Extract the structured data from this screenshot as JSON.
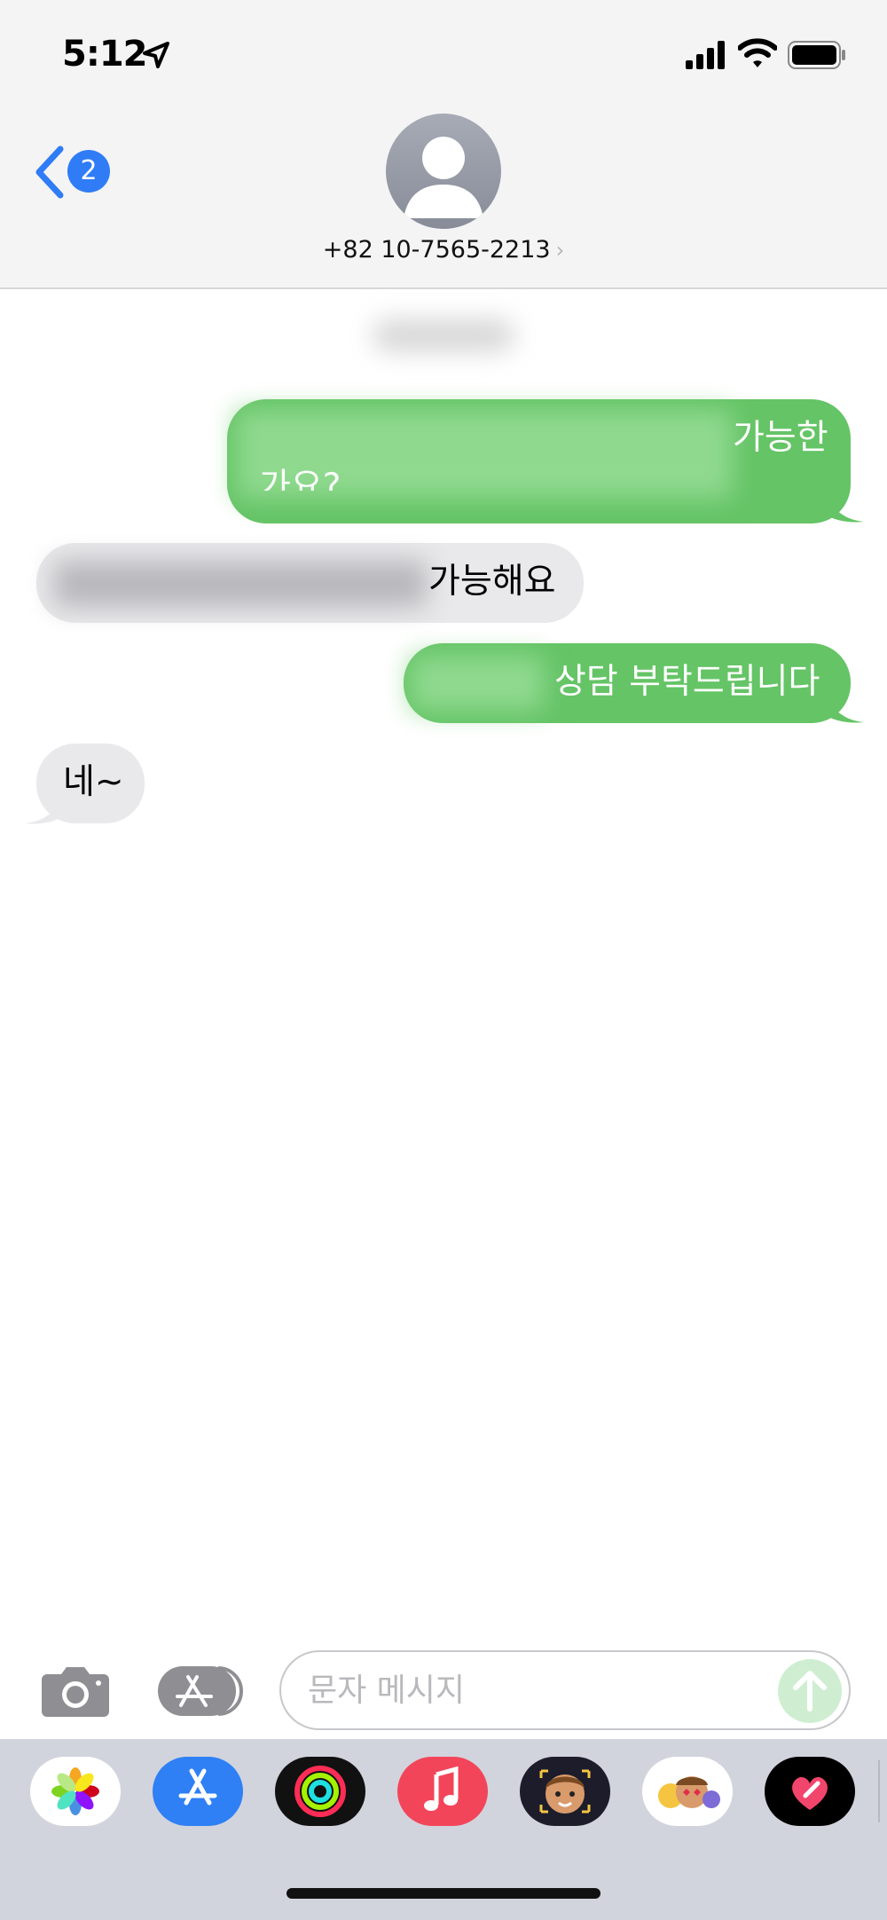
{
  "status_bar": {
    "time": "5:12"
  },
  "header": {
    "back_badge": "2",
    "contact_name": "+82 10-7565-2213",
    "contact_chevron": "›"
  },
  "messages": [
    {
      "direction": "outgoing",
      "visible_text": "가능한",
      "line2_partial": "가요?"
    },
    {
      "direction": "incoming",
      "visible_text": "가능해요"
    },
    {
      "direction": "outgoing",
      "visible_text": "상담 부탁드립니다"
    },
    {
      "direction": "incoming",
      "visible_text": "네~"
    }
  ],
  "composer": {
    "placeholder": "문자 메시지",
    "value": ""
  },
  "app_drawer": {
    "apps": [
      "photos-icon",
      "app-store-icon",
      "activity-icon",
      "music-icon",
      "memoji-icon",
      "memoji-stickers-icon",
      "digital-touch-icon"
    ]
  },
  "colors": {
    "outgoing_bubble": "#65c466",
    "incoming_bubble": "#e9e9eb",
    "accent": "#2f7cf6"
  }
}
